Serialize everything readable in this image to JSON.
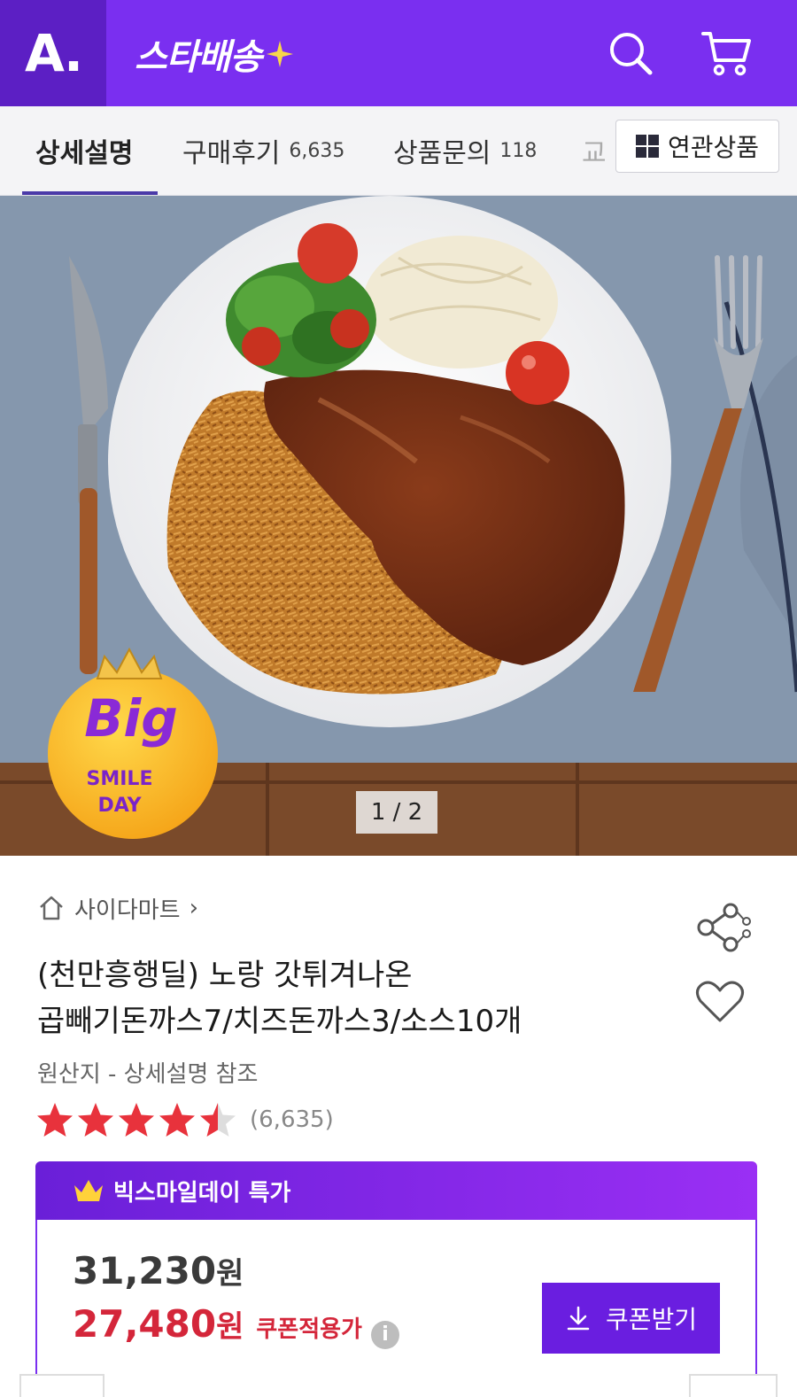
{
  "header": {
    "logo": "A.",
    "brand": "스타배송",
    "icons": [
      "search-icon",
      "cart-icon"
    ]
  },
  "tabs": [
    {
      "label": "상세설명",
      "count": ""
    },
    {
      "label": "구매후기",
      "count": "6,635"
    },
    {
      "label": "상품문의",
      "count": "118"
    },
    {
      "label": "교",
      "count": ""
    }
  ],
  "related_button": "연관상품",
  "hero": {
    "page_indicator": "1 / 2",
    "badge": {
      "big": "Big",
      "line1": "SMILE",
      "line2": "DAY"
    }
  },
  "product": {
    "store": "사이다마트",
    "title_line1": "(천만흥행딜) 노랑 갓튀겨나온",
    "title_line2": "곱빼기돈까스7/치즈돈까스3/소스10개",
    "origin": "원산지 - 상세설명 참조",
    "rating_value": 4.5,
    "rating_count": "(6,635)"
  },
  "deal": {
    "label": "빅스마일데이 특가",
    "original_price": "31,230",
    "sale_price": "27,480",
    "currency": "원",
    "sale_note": "쿠폰적용가",
    "coupon_button": "쿠폰받기"
  },
  "colors": {
    "brand_purple": "#7a2ff0",
    "sale_red": "#d4263a",
    "star_red": "#e8323c"
  }
}
